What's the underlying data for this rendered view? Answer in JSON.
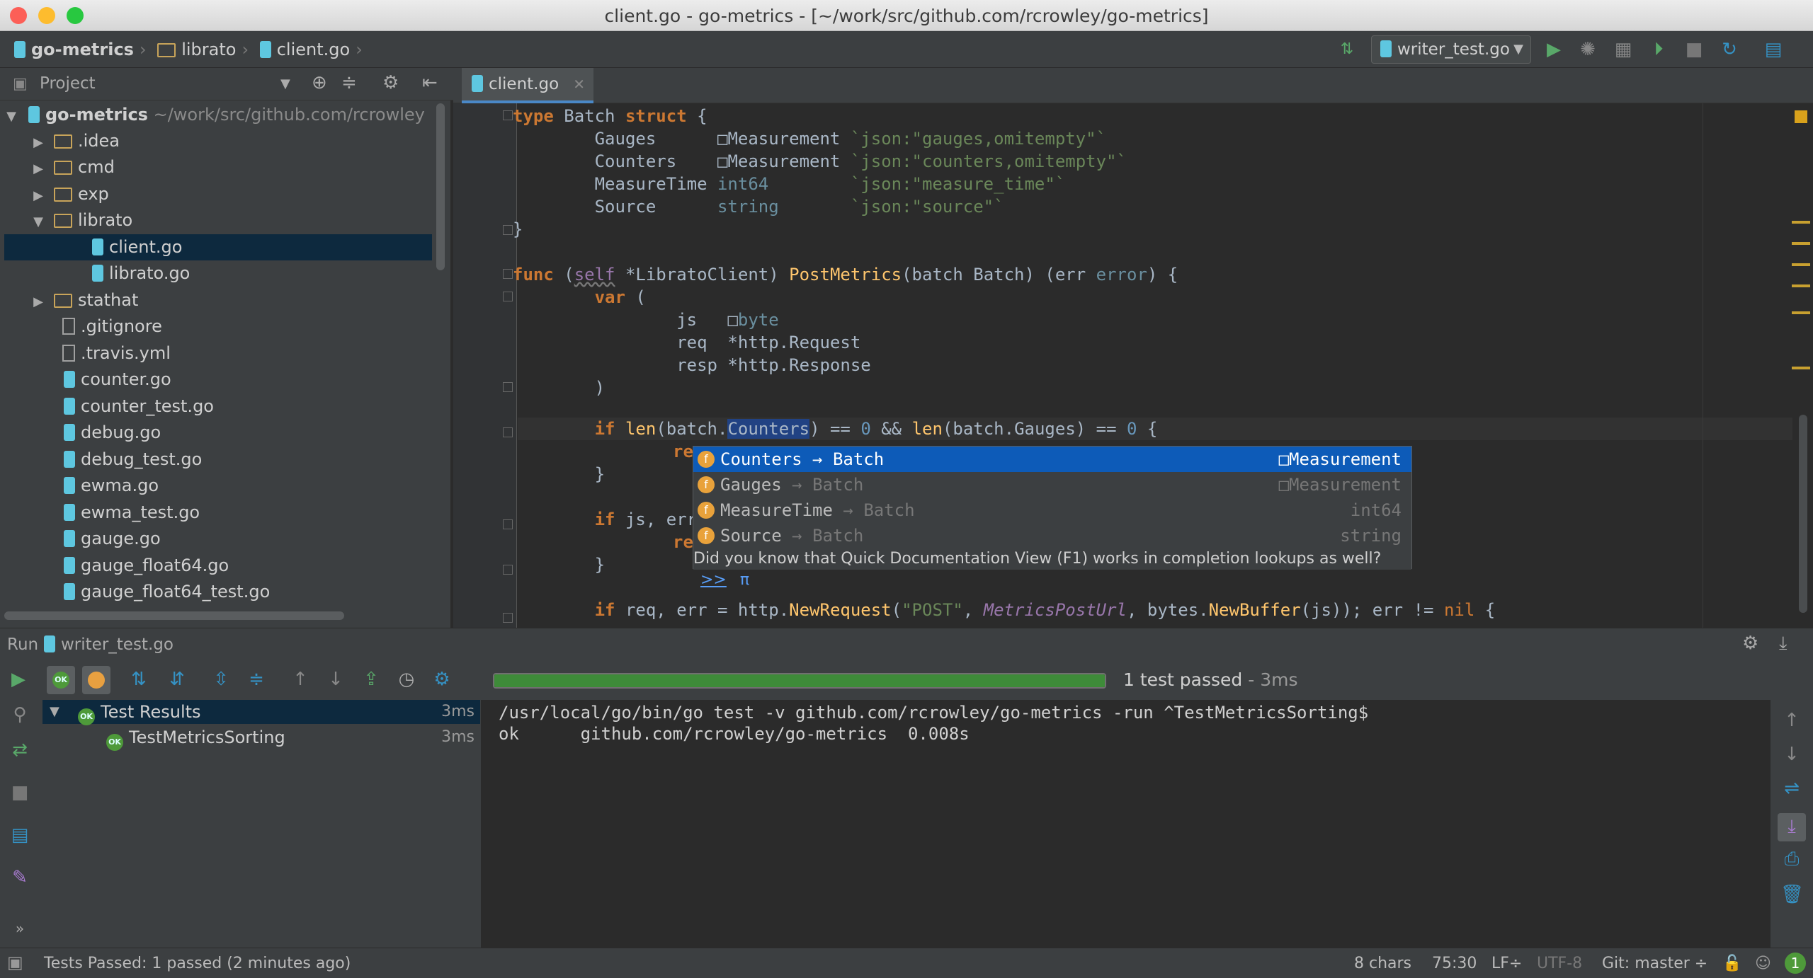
{
  "window": {
    "title": "client.go - go-metrics - [~/work/src/github.com/rcrowley/go-metrics]"
  },
  "navbar": {
    "breadcrumbs": [
      "go-metrics",
      "librato",
      "client.go"
    ],
    "run_config": "writer_test.go"
  },
  "project": {
    "title": "Project",
    "root": "go-metrics",
    "root_path": "~/work/src/github.com/rcrowley",
    "items": [
      {
        "name": ".idea"
      },
      {
        "name": "cmd"
      },
      {
        "name": "exp"
      },
      {
        "name": "librato"
      },
      {
        "name": "client.go"
      },
      {
        "name": "librato.go"
      },
      {
        "name": "stathat"
      },
      {
        "name": ".gitignore"
      },
      {
        "name": ".travis.yml"
      },
      {
        "name": "counter.go"
      },
      {
        "name": "counter_test.go"
      },
      {
        "name": "debug.go"
      },
      {
        "name": "debug_test.go"
      },
      {
        "name": "ewma.go"
      },
      {
        "name": "ewma_test.go"
      },
      {
        "name": "gauge.go"
      },
      {
        "name": "gauge_float64.go"
      },
      {
        "name": "gauge_float64_test.go"
      }
    ]
  },
  "editor": {
    "tab": "client.go",
    "code": {
      "l1": [
        "type",
        " Batch ",
        "struct",
        " {"
      ],
      "l2": "        Gauges      ",
      "l2t": "Measurement",
      "l2s": "`json:\"gauges,omitempty\"`",
      "l3": "        Counters    ",
      "l3t": "Measurement",
      "l3s": "`json:\"counters,omitempty\"`",
      "l4": "        MeasureTime ",
      "l4t": "int64",
      "l4s": "`json:\"measure_time\"`",
      "l5": "        Source      ",
      "l5t": "string",
      "l5s": "`json:\"source\"`",
      "l6": "}",
      "l8a": "func",
      "l8b": " (",
      "l8c": "self",
      "l8d": " *",
      "l8e": "LibratoClient",
      "l8f": ") ",
      "l8g": "PostMetrics",
      "l8h": "(batch Batch) (err ",
      "l8i": "error",
      "l8j": ") {",
      "l9a": "        ",
      "l9b": "var",
      "l9c": " (",
      "l10a": "                js   ",
      "l10b": "byte",
      "l11": "                req  *http.Request",
      "l12": "                resp *http.Response",
      "l13": "        )",
      "l15a": "        ",
      "l15b": "if",
      "l15c": " ",
      "l15d": "len",
      "l15e": "(batch.",
      "l15f": "Counters",
      "l15g": ") == ",
      "l15h": "0",
      "l15i": " && ",
      "l15j": "len",
      "l15k": "(batch.Gauges) == ",
      "l15l": "0",
      "l15m": " {",
      "l16": "re",
      "l17": "        }",
      "l19a": "        ",
      "l19b": "if",
      "l19c": " js, err",
      "l20": "re",
      "l21": "        }",
      "l23a": "        ",
      "l23b": "if",
      "l23c": " req, err = http.",
      "l23d": "NewRequest",
      "l23e": "(",
      "l23f": "\"POST\"",
      "l23g": ", ",
      "l23h": "MetricsPostUrl",
      "l23i": ", bytes.",
      "l23j": "NewBuffer",
      "l23k": "(js)); err != ",
      "l23l": "nil",
      "l23m": " {"
    },
    "completion": {
      "items": [
        {
          "name": "Counters",
          "owner": "Batch",
          "type": "Measurement"
        },
        {
          "name": "Gauges",
          "owner": "Batch",
          "type": "Measurement"
        },
        {
          "name": "MeasureTime",
          "owner": "Batch",
          "type": "int64"
        },
        {
          "name": "Source",
          "owner": "Batch",
          "type": "string"
        }
      ],
      "badge": "f",
      "arrow": "→",
      "tip": "Did you know that Quick Documentation View (F1) works in completion lookups as well?",
      "tip_link": ">>",
      "pi": "π"
    }
  },
  "run": {
    "label": "Run",
    "config": "writer_test.go",
    "progress": 1.0,
    "summary": "1 test passed",
    "summary_time": " - 3ms",
    "ok_badge": "OK",
    "tests": [
      {
        "name": "Test Results",
        "time": "3ms"
      },
      {
        "name": "TestMetricsSorting",
        "time": "3ms"
      }
    ],
    "console": [
      "/usr/local/go/bin/go test -v github.com/rcrowley/go-metrics -run ^TestMetricsSorting$",
      "ok      github.com/rcrowley/go-metrics  0.008s"
    ]
  },
  "status": {
    "message": "Tests Passed: 1 passed (2 minutes ago)",
    "chars": "8 chars",
    "position": "75:30",
    "line_sep": "LF÷",
    "encoding": "UTF-8",
    "git": "Git: master ÷",
    "notifications": "1"
  },
  "colors": {
    "accent": "#4a88c7",
    "selection": "#0d5bb8",
    "success": "#4e9a3a"
  }
}
